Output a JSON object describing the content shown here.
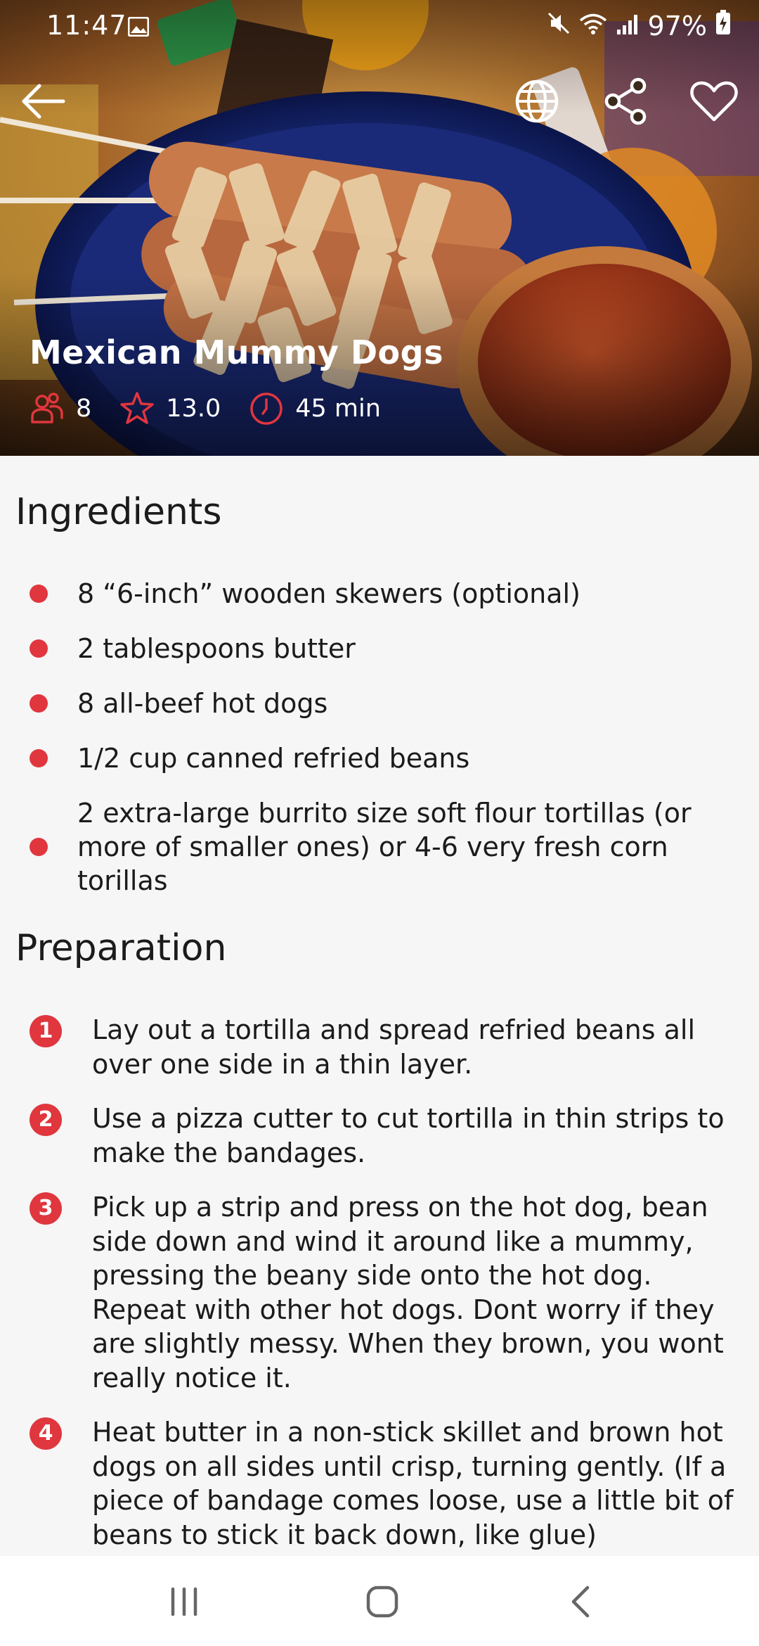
{
  "status_bar": {
    "time": "11:47",
    "battery": "97%"
  },
  "header": {
    "back_icon": "arrow-left-icon",
    "translate_icon": "globe-icon",
    "share_icon": "share-icon",
    "favorite_icon": "heart-icon"
  },
  "recipe": {
    "title": "Mexican Mummy Dogs",
    "servings": "8",
    "rating": "13.0",
    "time": "45 min"
  },
  "ingredients": {
    "title": "Ingredients",
    "items": [
      "8 “6-inch” wooden skewers (optional)",
      "2 tablespoons butter",
      "8 all-beef hot dogs",
      "1/2 cup canned refried beans",
      "2 extra-large burrito size soft flour tortillas (or more of smaller ones) or 4-6 very fresh corn torillas"
    ]
  },
  "preparation": {
    "title": "Preparation",
    "steps": [
      {
        "num": "1",
        "text": "Lay out a  tortilla and spread refried beans all over one side in a thin layer."
      },
      {
        "num": "2",
        "text": "Use a pizza cutter to cut tortilla in thin strips to make the bandages."
      },
      {
        "num": "3",
        "text": "Pick up a strip and press on the hot dog, bean side down and wind it around like a mummy, pressing the beany side onto the hot dog. Repeat with other hot dogs. Dont worry if they are slightly messy. When they brown, you wont really notice it."
      },
      {
        "num": "4",
        "text": "Heat butter in a non-stick skillet and brown hot dogs on all sides until crisp, turning gently. (If a piece of bandage comes loose, use a little bit of beans to stick it back down, like glue)"
      }
    ]
  },
  "colors": {
    "accent": "#e0363e",
    "background": "#f6f6f6",
    "text": "#1b1b1b"
  },
  "nav": {
    "recents_icon": "recents-icon",
    "home_icon": "home-icon",
    "back_icon": "back-icon"
  }
}
